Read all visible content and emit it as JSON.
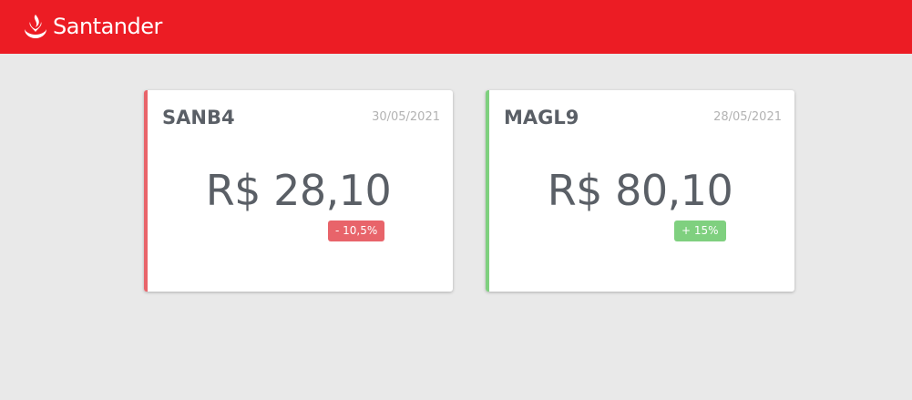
{
  "header": {
    "brand": "Santander",
    "background": "#ec1c24",
    "logo_icon": "flame-icon"
  },
  "cards": [
    {
      "ticker": "SANB4",
      "date": "30/05/2021",
      "price": "R$ 28,10",
      "change": "- 10,5%",
      "trend": "down",
      "accent_color": "#e8646a"
    },
    {
      "ticker": "MAGL9",
      "date": "28/05/2021",
      "price": "R$ 80,10",
      "change": "+ 15%",
      "trend": "up",
      "accent_color": "#7fd07f"
    }
  ]
}
